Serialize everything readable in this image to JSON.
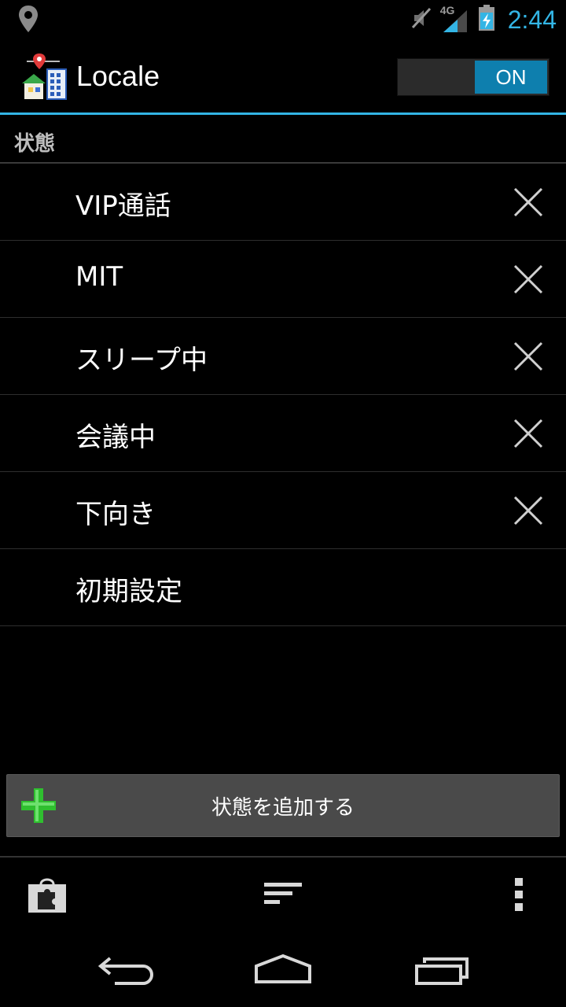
{
  "status_bar": {
    "time": "2:44",
    "network": "4G",
    "icons": [
      "location-icon",
      "mute-icon",
      "signal-icon",
      "battery-charging-icon"
    ]
  },
  "action_bar": {
    "title": "Locale",
    "toggle_label": "ON",
    "accent_color": "#33b5e5"
  },
  "section": {
    "title": "状態"
  },
  "list": {
    "items": [
      {
        "label": "VIP通話",
        "removable": true
      },
      {
        "label": "MIT",
        "removable": true
      },
      {
        "label": "スリープ中",
        "removable": true
      },
      {
        "label": "会議中",
        "removable": true
      },
      {
        "label": "下向き",
        "removable": true
      },
      {
        "label": "初期設定",
        "removable": false
      }
    ]
  },
  "add_button": {
    "label": "状態を追加する",
    "icon": "plus-icon"
  },
  "bottom_bar": {
    "icons": [
      "plugin-store-icon",
      "sort-icon",
      "overflow-menu-icon"
    ]
  },
  "nav_bar": {
    "icons": [
      "back-icon",
      "home-icon",
      "recent-apps-icon"
    ]
  }
}
